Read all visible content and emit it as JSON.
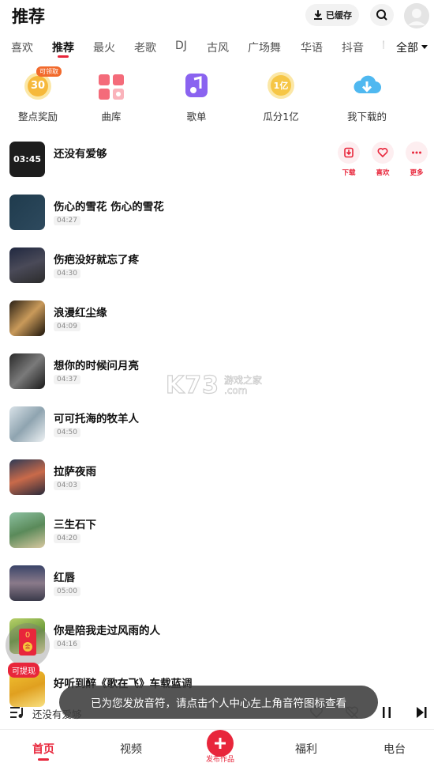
{
  "header": {
    "title": "推荐",
    "cache_label": "已缓存"
  },
  "tabs": [
    "喜欢",
    "推荐",
    "最火",
    "老歌",
    "DJ",
    "古风",
    "广场舞",
    "华语",
    "抖音",
    "I"
  ],
  "tab_all_label": "全部",
  "shortcuts": [
    {
      "label": "整点奖励",
      "icon": "coin-30-icon",
      "badge": "可领取",
      "value": "30"
    },
    {
      "label": "曲库",
      "icon": "library-grid-icon"
    },
    {
      "label": "歌单",
      "icon": "playlist-icon"
    },
    {
      "label": "瓜分1亿",
      "icon": "coin-share-icon",
      "value": "1亿"
    },
    {
      "label": "我下载的",
      "icon": "cloud-download-icon"
    }
  ],
  "songs": [
    {
      "title": "还没有爱够",
      "cover_time": "03:45"
    },
    {
      "title": "伤心的雪花 伤心的雪花",
      "duration": "04:27"
    },
    {
      "title": "伤疤没好就忘了疼",
      "duration": "04:30"
    },
    {
      "title": "浪漫红尘缘",
      "duration": "04:09"
    },
    {
      "title": "想你的时候问月亮",
      "duration": "04:37"
    },
    {
      "title": "可可托海的牧羊人",
      "duration": "04:50"
    },
    {
      "title": "拉萨夜雨",
      "duration": "04:03"
    },
    {
      "title": "三生石下",
      "duration": "04:20"
    },
    {
      "title": "红唇",
      "duration": "05:00"
    },
    {
      "title": "你是陪我走过风雨的人",
      "duration": "04:16"
    },
    {
      "title": "好听到醉《歌在飞》车载蓝调"
    }
  ],
  "song_actions": [
    "下载",
    "喜欢",
    "更多"
  ],
  "watermark": {
    "logo": "K73",
    "line1": "游戏之家",
    "line2": ".com"
  },
  "float_widget": {
    "count": "0",
    "coin": "金",
    "tag": "可提现"
  },
  "toast": "已为您发放音符，请点击个人中心左上角音符图标查看",
  "player": {
    "now_playing": "还没有爱够"
  },
  "bottom_nav": {
    "home": "首页",
    "video": "视频",
    "publish": "发布作品",
    "welfare": "福利",
    "radio": "电台"
  },
  "colors": {
    "accent": "#e8263b",
    "toast_bg": "#3c3c3c"
  }
}
